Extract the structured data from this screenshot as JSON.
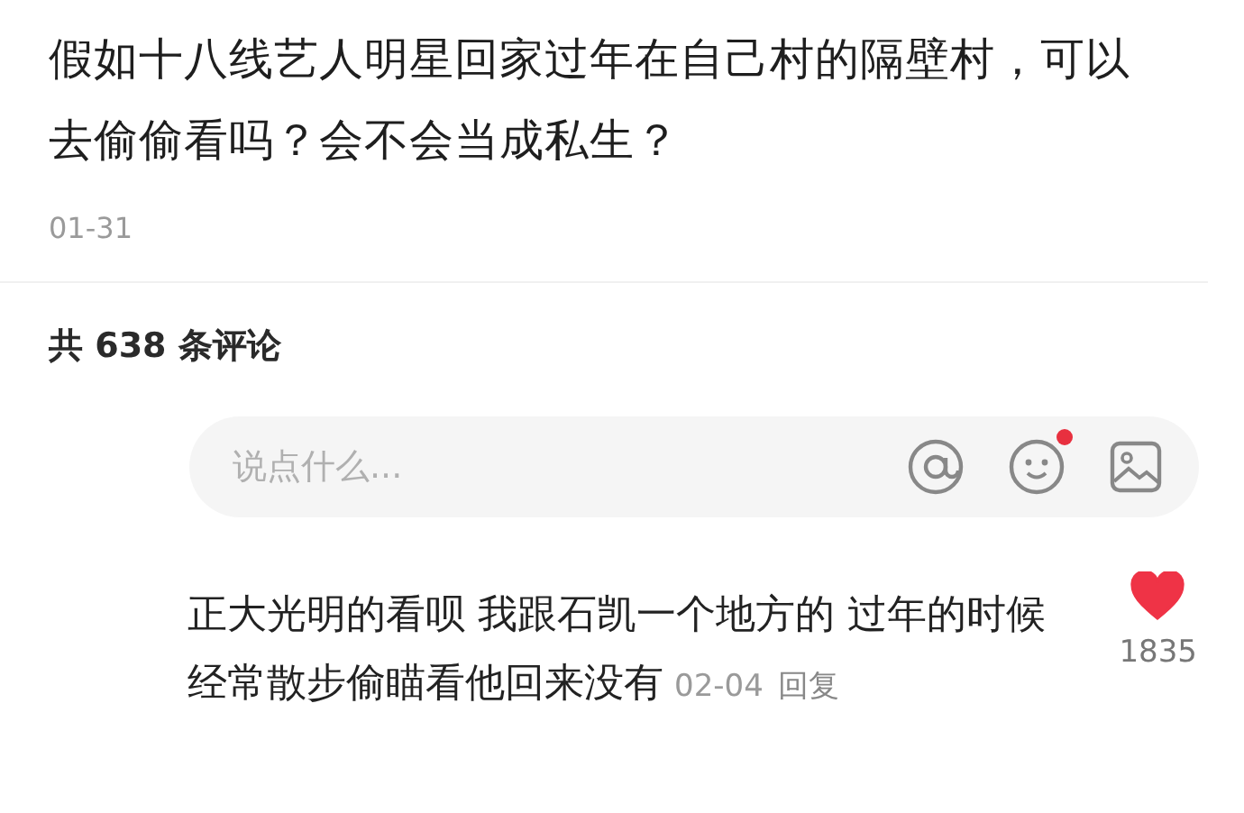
{
  "post": {
    "title": "假如十八线艺人明星回家过年在自己村的隔壁村，可以去偷偷看吗？会不会当成私生？",
    "date": "01-31"
  },
  "comments_header": "共 638 条评论",
  "comment_input": {
    "placeholder": "说点什么...",
    "emoji_badge": true
  },
  "comments": [
    {
      "text": "正大光明的看呗 我跟石凯一个地方的 过年的时候经常散步偷瞄看他回来没有",
      "date": "02-04",
      "reply": "回复",
      "liked": true,
      "likes": "1835"
    }
  ]
}
